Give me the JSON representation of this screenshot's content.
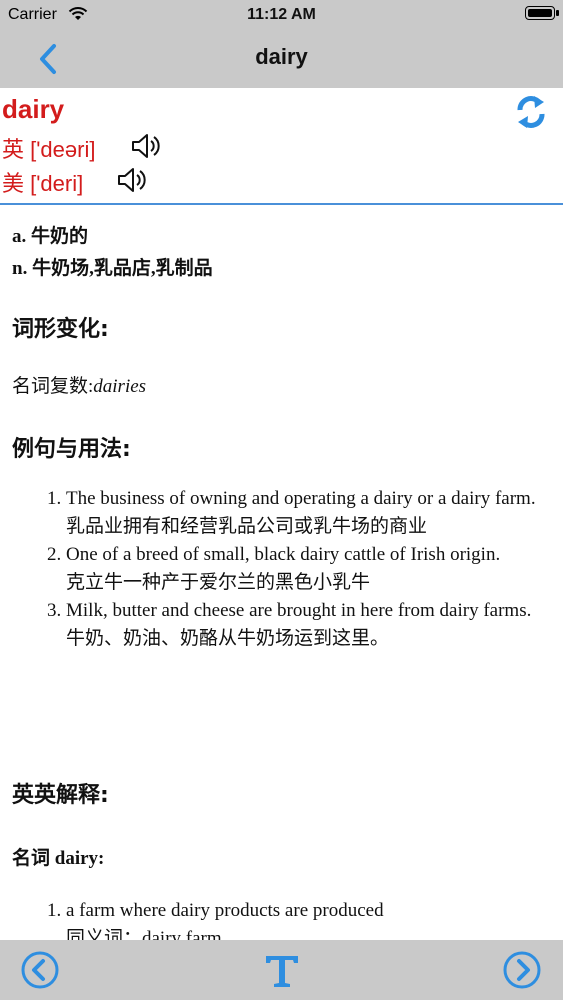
{
  "status_bar": {
    "carrier": "Carrier",
    "time": "11:12 AM"
  },
  "nav": {
    "title": "dairy",
    "back_icon": "chevron-left-icon"
  },
  "entry": {
    "word": "dairy",
    "uk_pron": "英 ['deəri]",
    "us_pron": "美 ['deri]",
    "definitions": [
      "a. 牛奶的",
      "n. 牛奶场,乳品店,乳制品"
    ]
  },
  "sections": {
    "inflection_title": "词形变化:",
    "inflection_label": "名词复数:",
    "inflection_value": "dairies",
    "examples_title": "例句与用法:",
    "examples": [
      {
        "en": "The business of owning and operating a dairy or a dairy farm.",
        "zh": "乳品业拥有和经营乳品公司或乳牛场的商业"
      },
      {
        "en": "One of a breed of small, black dairy cattle of Irish origin.",
        "zh": "克立牛一种产于爱尔兰的黑色小乳牛"
      },
      {
        "en": "Milk, butter and cheese are brought in here from dairy farms.",
        "zh": "牛奶、奶油、奶酪从牛奶场运到这里。"
      }
    ],
    "english_title": "英英解释:",
    "english_pos": "名词 dairy:",
    "english_items": [
      {
        "en": "a farm where dairy products are produced",
        "zh": "同义词：dairy farm"
      }
    ]
  },
  "toolbar": {
    "prev_icon": "arrow-left-circle-icon",
    "font_icon": "text-size-icon",
    "next_icon": "arrow-right-circle-icon"
  },
  "colors": {
    "accent": "#2e8ee0",
    "headword": "#d31c1c",
    "bar": "#c9c9c9"
  }
}
